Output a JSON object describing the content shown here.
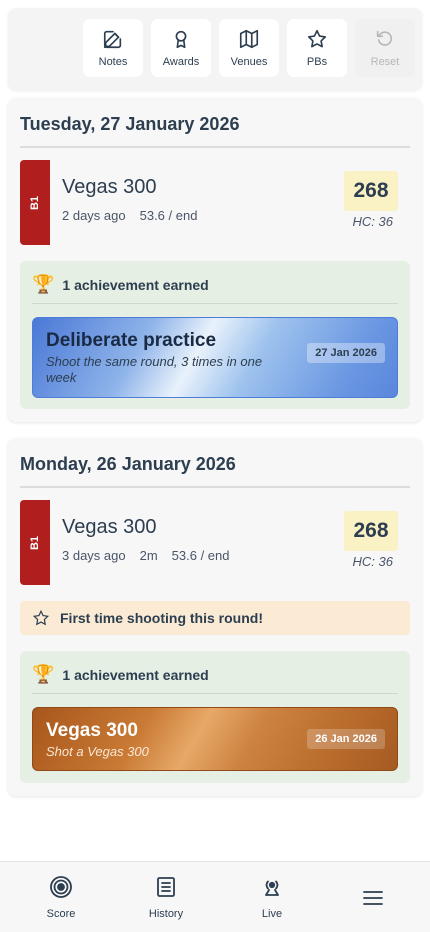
{
  "toolbar": {
    "buttons": [
      {
        "label": "Notes",
        "icon": "edit-icon",
        "enabled": true
      },
      {
        "label": "Awards",
        "icon": "award-icon",
        "enabled": true
      },
      {
        "label": "Venues",
        "icon": "map-icon",
        "enabled": true
      },
      {
        "label": "PBs",
        "icon": "star-icon",
        "enabled": true
      },
      {
        "label": "Reset",
        "icon": "reset-icon",
        "enabled": false
      }
    ]
  },
  "days": [
    {
      "date_label": "Tuesday, 27 January 2026",
      "entry": {
        "face_tag": "B1",
        "round_name": "Vegas 300",
        "ago": "2 days ago",
        "duration": "",
        "avg": "53.6 / end",
        "score": "268",
        "hc": "HC: 36"
      },
      "achievements": {
        "header": "1 achievement earned",
        "items": [
          {
            "title": "Deliberate practice",
            "subtitle": "Shoot the same round, 3 times in one week",
            "date": "27 Jan 2026",
            "style": "blue"
          }
        ]
      }
    },
    {
      "date_label": "Monday, 26 January 2026",
      "entry": {
        "face_tag": "B1",
        "round_name": "Vegas 300",
        "ago": "3 days ago",
        "duration": "2m",
        "avg": "53.6 / end",
        "score": "268",
        "hc": "HC: 36"
      },
      "first_time_banner": "First time shooting this round!",
      "achievements": {
        "header": "1 achievement earned",
        "items": [
          {
            "title": "Vegas 300",
            "subtitle": "Shot a Vegas 300",
            "date": "26 Jan 2026",
            "style": "bronze"
          }
        ]
      }
    }
  ],
  "bottom_nav": {
    "items": [
      {
        "label": "Score",
        "icon": "target-icon"
      },
      {
        "label": "History",
        "icon": "history-icon"
      },
      {
        "label": "Live",
        "icon": "live-icon"
      },
      {
        "label": "",
        "icon": "menu-icon"
      }
    ]
  }
}
